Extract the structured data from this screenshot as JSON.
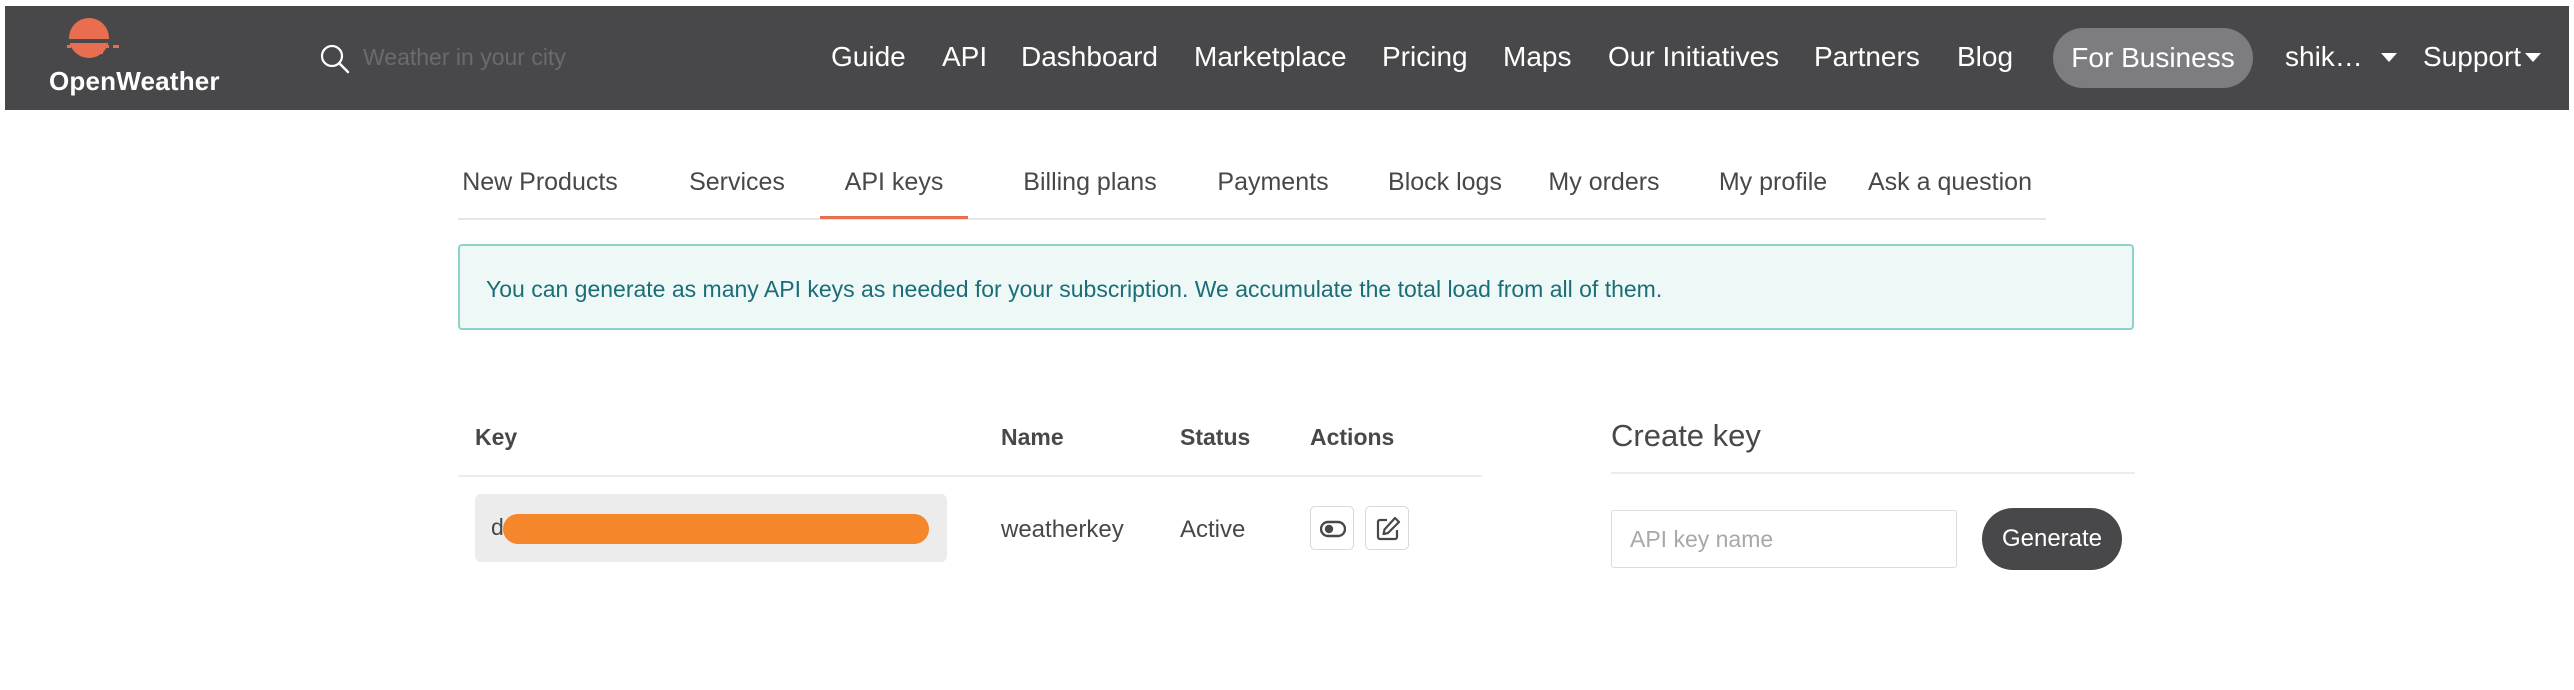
{
  "colors": {
    "topbar_bg": "#48484a",
    "accent": "#e96e50",
    "alert_bg": "#eef8f6",
    "alert_border": "#8fd3c8",
    "alert_text": "#1b6d77",
    "redaction": "#f6862c"
  },
  "header": {
    "logo_text": "OpenWeather",
    "logo_icon": "openweather-sun-logo",
    "search_icon": "search-icon",
    "search_placeholder": "Weather in your city",
    "nav": [
      "Guide",
      "API",
      "Dashboard",
      "Marketplace",
      "Pricing",
      "Maps",
      "Our Initiatives",
      "Partners",
      "Blog"
    ],
    "for_business": "For Business",
    "user_menu": "shik…",
    "support": "Support"
  },
  "tabs": {
    "items": [
      "New Products",
      "Services",
      "API keys",
      "Billing plans",
      "Payments",
      "Block logs",
      "My orders",
      "My profile",
      "Ask a question"
    ],
    "active": "API keys"
  },
  "alert": {
    "text": "You can generate as many API keys as needed for your subscription. We accumulate the total load from all of them."
  },
  "keys_table": {
    "headers": [
      "Key",
      "Name",
      "Status",
      "Actions"
    ],
    "rows": [
      {
        "key_visible_prefix": "d",
        "key_redacted": true,
        "name": "weatherkey",
        "status": "Active",
        "actions": [
          "toggle-icon",
          "edit-icon"
        ]
      }
    ]
  },
  "create_key": {
    "title": "Create key",
    "input_placeholder": "API key name",
    "input_value": "",
    "button": "Generate"
  }
}
